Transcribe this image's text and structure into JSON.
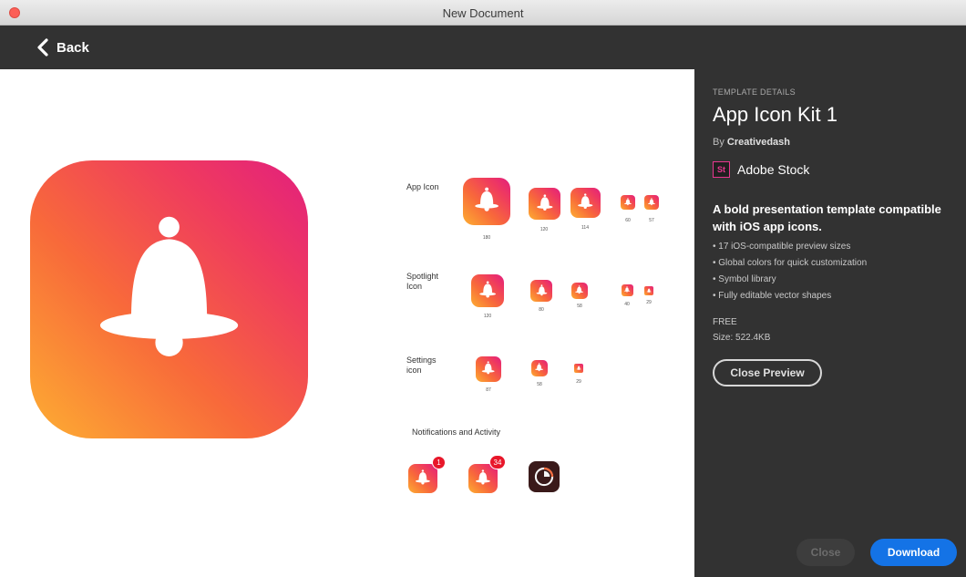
{
  "window": {
    "title": "New Document"
  },
  "nav": {
    "back_label": "Back"
  },
  "preview": {
    "rows": [
      {
        "label": "App Icon",
        "sizes": [
          "180",
          "120",
          "114",
          "60",
          "57"
        ]
      },
      {
        "label": "Spotlight Icon",
        "sizes": [
          "120",
          "80",
          "58",
          "40",
          "29"
        ]
      },
      {
        "label": "Settings icon",
        "sizes": [
          "87",
          "58",
          "29"
        ]
      }
    ],
    "notifications_label": "Notifications and Activity",
    "badges": [
      "1",
      "34"
    ]
  },
  "panel": {
    "eyebrow": "TEMPLATE DETAILS",
    "title": "App Icon Kit 1",
    "by_prefix": "By",
    "author": "Creativedash",
    "stock_logo": "St",
    "stock_label": "Adobe Stock",
    "description": "A bold presentation template compatible with iOS app icons.",
    "features": [
      "17 iOS-compatible preview sizes",
      "Global colors for quick customization",
      "Symbol library",
      "Fully editable vector shapes"
    ],
    "price": "FREE",
    "size": "Size: 522.4KB",
    "close_preview_label": "Close Preview",
    "close_label": "Close",
    "download_label": "Download"
  },
  "colors": {
    "gradient_start": "#fdae32",
    "gradient_end": "#e21f7e",
    "accent_blue": "#1473e6",
    "stock_pink": "#e8378f",
    "panel_bg": "#323232"
  },
  "icons": [
    "close-window-icon",
    "chevron-left-icon",
    "bell-icon",
    "activity-ring-icon"
  ]
}
